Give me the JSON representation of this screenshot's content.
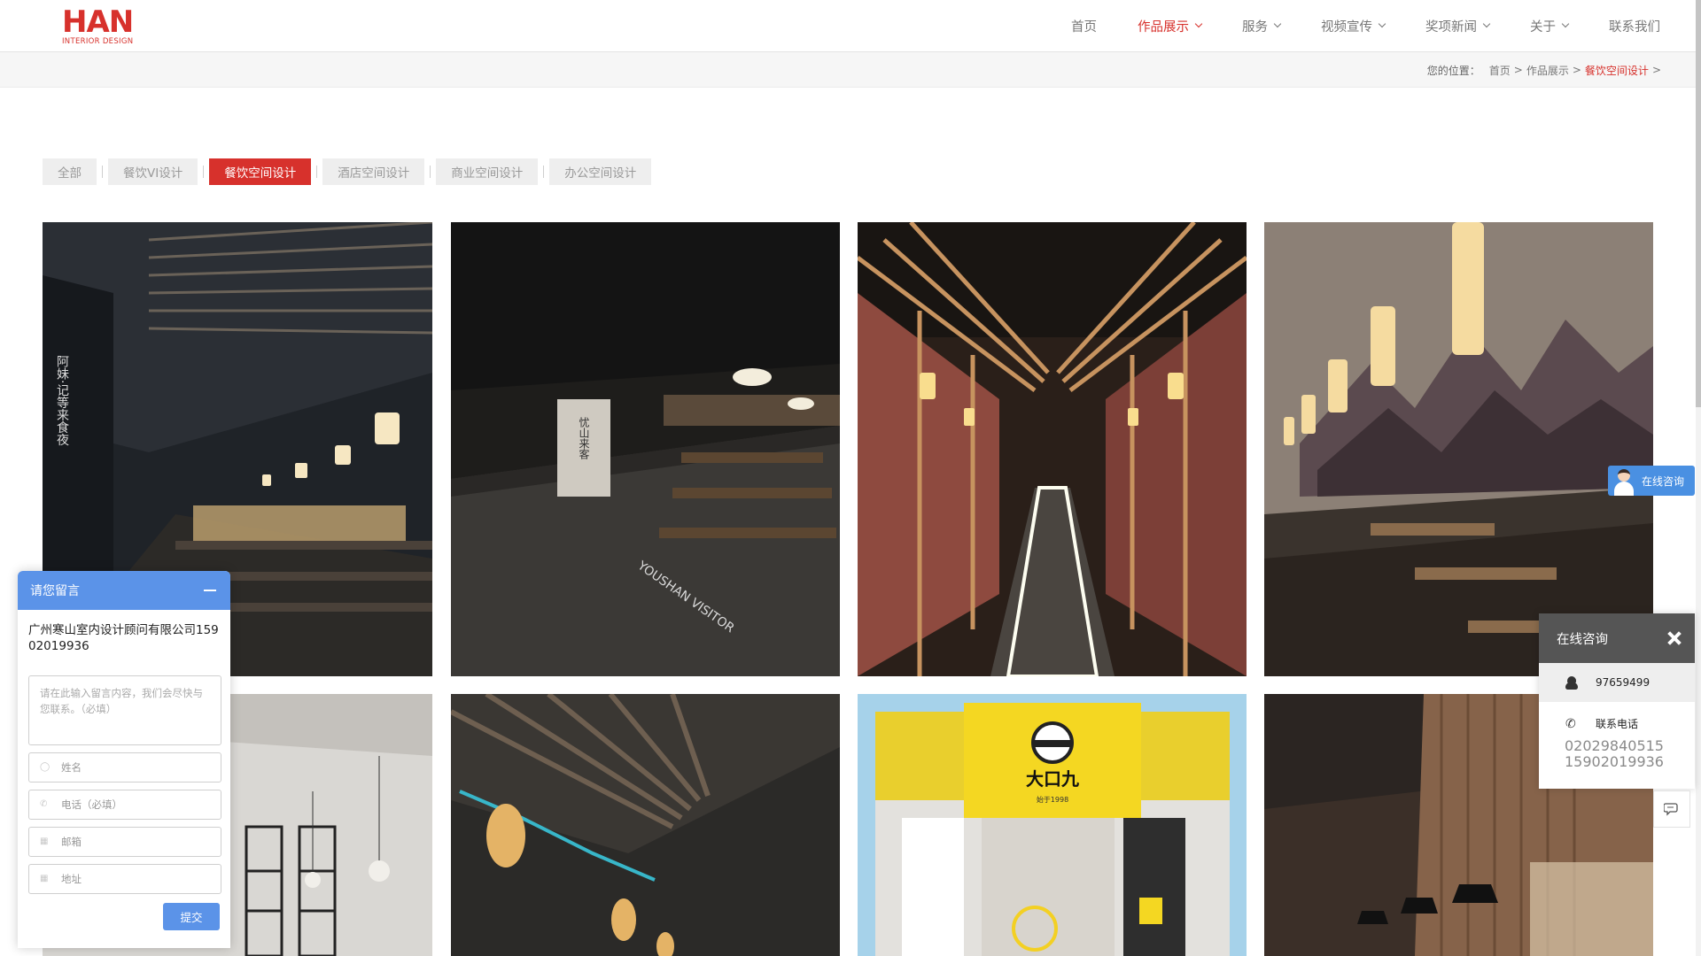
{
  "header": {
    "logo_text": "HAN",
    "logo_sub": "INTERIOR DESIGN",
    "nav": [
      {
        "label": "首页",
        "dropdown": false,
        "active": false
      },
      {
        "label": "作品展示",
        "dropdown": true,
        "active": true
      },
      {
        "label": "服务",
        "dropdown": true,
        "active": false
      },
      {
        "label": "视频宣传",
        "dropdown": true,
        "active": false
      },
      {
        "label": "奖项新闻",
        "dropdown": true,
        "active": false
      },
      {
        "label": "关于",
        "dropdown": true,
        "active": false
      },
      {
        "label": "联系我们",
        "dropdown": false,
        "active": false
      }
    ]
  },
  "breadcrumb": {
    "label": "您的位置：",
    "items": [
      "首页",
      ">",
      "作品展示",
      ">",
      "餐饮空间设计",
      ">"
    ]
  },
  "filters": [
    {
      "label": "全部",
      "active": false
    },
    {
      "label": "餐饮VI设计",
      "active": false
    },
    {
      "label": "餐饮空间设计",
      "active": true
    },
    {
      "label": "酒店空间设计",
      "active": false
    },
    {
      "label": "商业空间设计",
      "active": false
    },
    {
      "label": "办公空间设计",
      "active": false
    }
  ],
  "gallery": {
    "tile1_sign": "阿妹·记等来食夜",
    "tile2_floor": "YOUSHAN VISITOR",
    "tile2_sign": "忧山来客",
    "tile7_sign": "大口九",
    "tile7_sub": "始于1998"
  },
  "consult_tab": {
    "label": "在线咨询"
  },
  "right_panel": {
    "title": "在线咨询",
    "qq": "97659499",
    "phone_label": "联系电话",
    "phones": [
      "02029840515",
      "15902019936"
    ]
  },
  "message_form": {
    "title": "请您留言",
    "company": "广州寒山室内设计顾问有限公司15902019936",
    "textarea_placeholder": "请在此输入留言内容，我们会尽快与您联系。（必填）",
    "name_placeholder": "姓名",
    "phone_placeholder": "电话（必填）",
    "email_placeholder": "邮箱",
    "address_placeholder": "地址",
    "submit": "提交"
  },
  "colors": {
    "accent": "#d7312c",
    "form_blue": "#5b93e8",
    "panel_head": "#555555"
  }
}
